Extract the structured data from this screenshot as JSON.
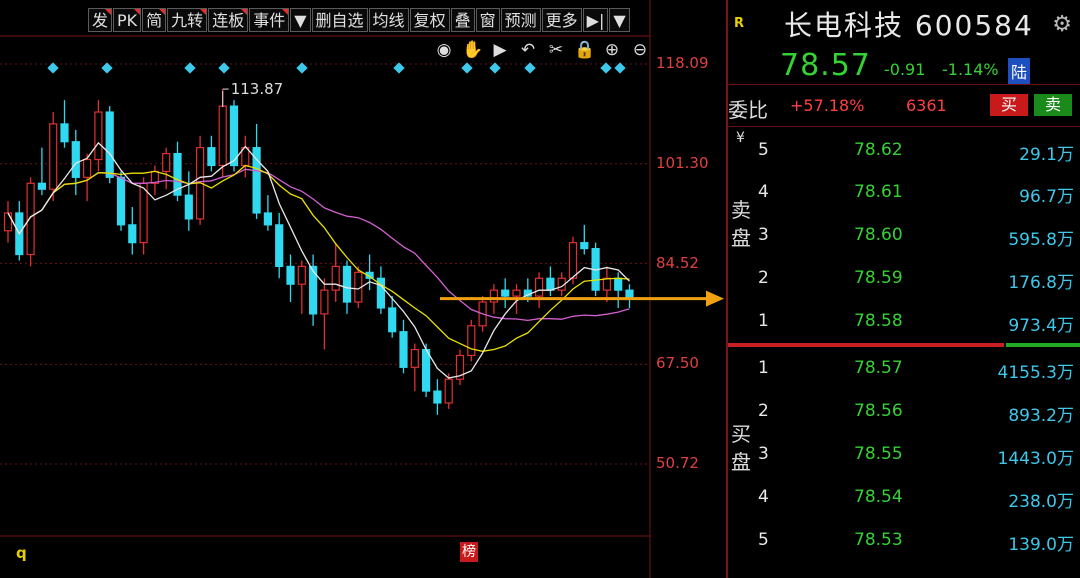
{
  "toolbar": {
    "buttons": [
      {
        "label": "发",
        "flag": true
      },
      {
        "label": "PK",
        "flag": true
      },
      {
        "label": "简",
        "flag": true
      },
      {
        "label": "九转",
        "flag": true
      },
      {
        "label": "连板",
        "flag": true
      },
      {
        "label": "事件",
        "flag": true
      },
      {
        "label": "▼",
        "flag": false
      },
      {
        "label": "删自选",
        "flag": false
      },
      {
        "label": "均线",
        "flag": false
      },
      {
        "label": "复权",
        "flag": false
      },
      {
        "label": "叠",
        "flag": false
      },
      {
        "label": "窗",
        "flag": false
      },
      {
        "label": "预测",
        "flag": false
      },
      {
        "label": "更多",
        "flag": false
      },
      {
        "label": "▶|",
        "flag": false
      },
      {
        "label": "▼",
        "flag": false
      }
    ],
    "tool_icons": [
      "eye-icon",
      "hand-icon",
      "play-icon",
      "undo-icon",
      "scissors-icon",
      "lock-icon",
      "zoom-in-icon",
      "zoom-out-icon"
    ]
  },
  "chart": {
    "price_labels": [
      "118.09",
      "101.30",
      "84.52",
      "67.50",
      "50.72"
    ],
    "peak_label": "113.87",
    "bottom_left_mark": "q",
    "bottom_badge": "榜",
    "colors": {
      "up": "#e03030",
      "down": "#30d8f0",
      "ma5": "#e8e8e8",
      "ma10": "#e8e000",
      "ma20": "#d060d0",
      "arrow": "#f0a010"
    }
  },
  "chart_data": {
    "type": "candlestick",
    "y_ticks": [
      118.09,
      101.3,
      84.52,
      67.5,
      50.72
    ],
    "peak": 113.87,
    "candles": [
      [
        90,
        95,
        88,
        93
      ],
      [
        93,
        95,
        85,
        86
      ],
      [
        86,
        99,
        84,
        98
      ],
      [
        98,
        104,
        96,
        97
      ],
      [
        97,
        110,
        95,
        108
      ],
      [
        108,
        112,
        104,
        105
      ],
      [
        105,
        107,
        96,
        99
      ],
      [
        99,
        103,
        95,
        102
      ],
      [
        102,
        112,
        100,
        110
      ],
      [
        110,
        111,
        98,
        99
      ],
      [
        99,
        100,
        90,
        91
      ],
      [
        91,
        94,
        86,
        88
      ],
      [
        88,
        99,
        86,
        98
      ],
      [
        98,
        101,
        96,
        100
      ],
      [
        100,
        104,
        97,
        103
      ],
      [
        103,
        105,
        95,
        96
      ],
      [
        96,
        100,
        90,
        92
      ],
      [
        92,
        106,
        91,
        104
      ],
      [
        104,
        106,
        100,
        101
      ],
      [
        101,
        113.87,
        99,
        111
      ],
      [
        111,
        112,
        100,
        101
      ],
      [
        101,
        106,
        99,
        104
      ],
      [
        104,
        108,
        92,
        93
      ],
      [
        93,
        96,
        90,
        91
      ],
      [
        91,
        93,
        82,
        84
      ],
      [
        84,
        86,
        78,
        81
      ],
      [
        81,
        85,
        76,
        84
      ],
      [
        84,
        86,
        74,
        76
      ],
      [
        76,
        82,
        70,
        80
      ],
      [
        80,
        88,
        78,
        84
      ],
      [
        84,
        85,
        76,
        78
      ],
      [
        78,
        84,
        77,
        83
      ],
      [
        83,
        86,
        80,
        82
      ],
      [
        82,
        84,
        76,
        77
      ],
      [
        77,
        79,
        72,
        73
      ],
      [
        73,
        75,
        66,
        67
      ],
      [
        67,
        71,
        63,
        70
      ],
      [
        70,
        71,
        62,
        63
      ],
      [
        63,
        65,
        59,
        61
      ],
      [
        61,
        66,
        60,
        65
      ],
      [
        65,
        70,
        64,
        69
      ],
      [
        69,
        75,
        68,
        74
      ],
      [
        74,
        79,
        73,
        78
      ],
      [
        78,
        81,
        76,
        80
      ],
      [
        80,
        82,
        77,
        79
      ],
      [
        79,
        81,
        76,
        80
      ],
      [
        80,
        82,
        78,
        79
      ],
      [
        79,
        83,
        77,
        82
      ],
      [
        82,
        84,
        79,
        80
      ],
      [
        80,
        83,
        79,
        82
      ],
      [
        82,
        89,
        81,
        88
      ],
      [
        88,
        91,
        86,
        87
      ],
      [
        87,
        88,
        79,
        80
      ],
      [
        80,
        84,
        78,
        82
      ],
      [
        82,
        83,
        77,
        80
      ],
      [
        80,
        81,
        77,
        78.57
      ]
    ]
  },
  "quote": {
    "r_badge": "R",
    "name": "长电科技 600584",
    "price": "78.57",
    "change": "-0.91",
    "change_pct": "-1.14%",
    "market": "陆"
  },
  "order_book": {
    "wb_label": "委比",
    "wb_pct": "+57.18%",
    "wb_diff": "6361",
    "buy_label": "买",
    "sell_label": "卖",
    "sell_side_label": "卖盘",
    "buy_side_label": "买盘",
    "yen": "¥",
    "asks": [
      {
        "level": "5",
        "price": "78.62",
        "vol": "29.1万"
      },
      {
        "level": "4",
        "price": "78.61",
        "vol": "96.7万"
      },
      {
        "level": "3",
        "price": "78.60",
        "vol": "595.8万"
      },
      {
        "level": "2",
        "price": "78.59",
        "vol": "176.8万"
      },
      {
        "level": "1",
        "price": "78.58",
        "vol": "973.4万"
      }
    ],
    "bids": [
      {
        "level": "1",
        "price": "78.57",
        "vol": "4155.3万"
      },
      {
        "level": "2",
        "price": "78.56",
        "vol": "893.2万"
      },
      {
        "level": "3",
        "price": "78.55",
        "vol": "1443.0万"
      },
      {
        "level": "4",
        "price": "78.54",
        "vol": "238.0万"
      },
      {
        "level": "5",
        "price": "78.53",
        "vol": "139.0万"
      }
    ]
  }
}
